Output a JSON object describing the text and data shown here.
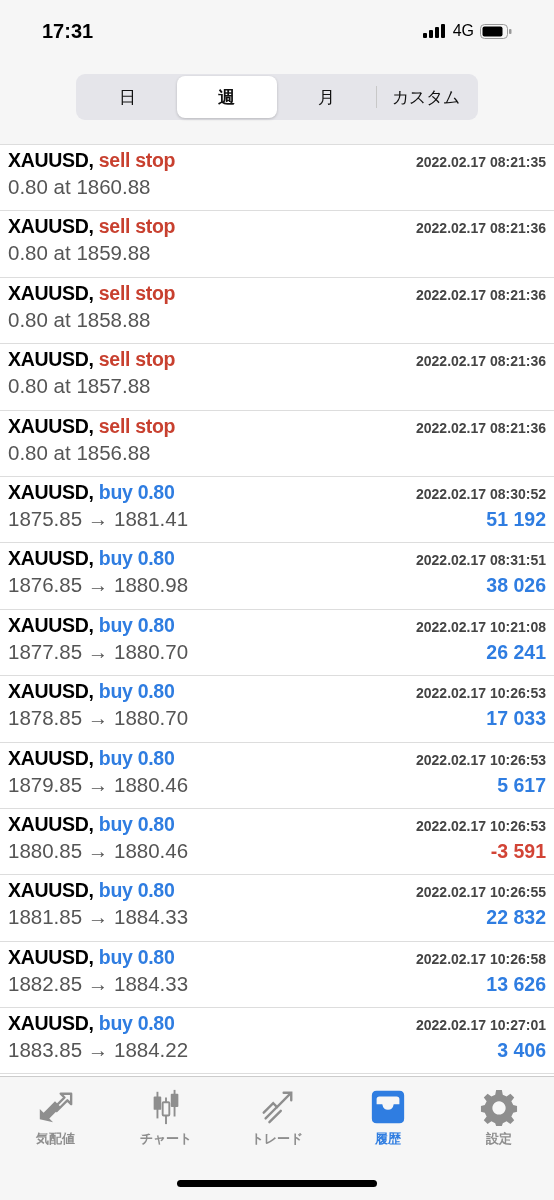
{
  "status_bar": {
    "time": "17:31",
    "network": "4G"
  },
  "periods": [
    {
      "label": "日",
      "selected": false
    },
    {
      "label": "週",
      "selected": true
    },
    {
      "label": "月",
      "selected": false
    },
    {
      "label": "カスタム",
      "selected": false
    }
  ],
  "history": [
    {
      "kind": "order",
      "symbol": "XAUUSD,",
      "color": "#c8402f",
      "action": "sell stop",
      "detail": "0.80 at 1860.88",
      "time": "2022.02.17 08:21:35"
    },
    {
      "kind": "order",
      "symbol": "XAUUSD,",
      "color": "#c8402f",
      "action": "sell stop",
      "detail": "0.80 at 1859.88",
      "time": "2022.02.17 08:21:36"
    },
    {
      "kind": "order",
      "symbol": "XAUUSD,",
      "color": "#c8402f",
      "action": "sell stop",
      "detail": "0.80 at 1858.88",
      "time": "2022.02.17 08:21:36"
    },
    {
      "kind": "order",
      "symbol": "XAUUSD,",
      "color": "#c8402f",
      "action": "sell stop",
      "detail": "0.80 at 1857.88",
      "time": "2022.02.17 08:21:36"
    },
    {
      "kind": "order",
      "symbol": "XAUUSD,",
      "color": "#c8402f",
      "action": "sell stop",
      "detail": "0.80 at 1856.88",
      "time": "2022.02.17 08:21:36"
    },
    {
      "kind": "deal",
      "symbol": "XAUUSD,",
      "color": "#2f7de1",
      "action": "buy 0.80",
      "detail": "1875.85 → 1881.41",
      "time": "2022.02.17 08:30:52",
      "profit": "51 192",
      "loss": false
    },
    {
      "kind": "deal",
      "symbol": "XAUUSD,",
      "color": "#2f7de1",
      "action": "buy 0.80",
      "detail": "1876.85 → 1880.98",
      "time": "2022.02.17 08:31:51",
      "profit": "38 026",
      "loss": false
    },
    {
      "kind": "deal",
      "symbol": "XAUUSD,",
      "color": "#2f7de1",
      "action": "buy 0.80",
      "detail": "1877.85 → 1880.70",
      "time": "2022.02.17 10:21:08",
      "profit": "26 241",
      "loss": false
    },
    {
      "kind": "deal",
      "symbol": "XAUUSD,",
      "color": "#2f7de1",
      "action": "buy 0.80",
      "detail": "1878.85 → 1880.70",
      "time": "2022.02.17 10:26:53",
      "profit": "17 033",
      "loss": false
    },
    {
      "kind": "deal",
      "symbol": "XAUUSD,",
      "color": "#2f7de1",
      "action": "buy 0.80",
      "detail": "1879.85 → 1880.46",
      "time": "2022.02.17 10:26:53",
      "profit": "5 617",
      "loss": false
    },
    {
      "kind": "deal",
      "symbol": "XAUUSD,",
      "color": "#2f7de1",
      "action": "buy 0.80",
      "detail": "1880.85 → 1880.46",
      "time": "2022.02.17 10:26:53",
      "profit": "-3 591",
      "loss": true
    },
    {
      "kind": "deal",
      "symbol": "XAUUSD,",
      "color": "#2f7de1",
      "action": "buy 0.80",
      "detail": "1881.85 → 1884.33",
      "time": "2022.02.17 10:26:55",
      "profit": "22 832",
      "loss": false
    },
    {
      "kind": "deal",
      "symbol": "XAUUSD,",
      "color": "#2f7de1",
      "action": "buy 0.80",
      "detail": "1882.85 → 1884.33",
      "time": "2022.02.17 10:26:58",
      "profit": "13 626",
      "loss": false
    },
    {
      "kind": "deal",
      "symbol": "XAUUSD,",
      "color": "#2f7de1",
      "action": "buy 0.80",
      "detail": "1883.85 → 1884.22",
      "time": "2022.02.17 10:27:01",
      "profit": "3 406",
      "loss": false
    }
  ],
  "tab_bar": [
    {
      "kind": "arrows",
      "label": "気配値",
      "selected": false
    },
    {
      "kind": "candles",
      "label": "チャート",
      "selected": false
    },
    {
      "kind": "trend",
      "label": "トレード",
      "selected": false
    },
    {
      "kind": "inbox",
      "label": "履歴",
      "selected": true
    },
    {
      "kind": "gear",
      "label": "設定",
      "selected": false
    }
  ]
}
